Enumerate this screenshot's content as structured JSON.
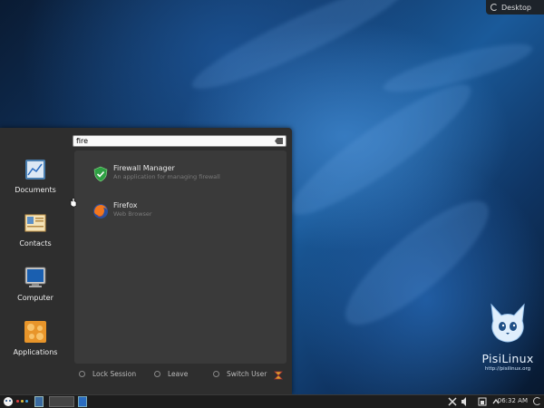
{
  "desktop_button": {
    "label": "Desktop"
  },
  "logo": {
    "brand": "PisiLinux",
    "url": "http://pisilinux.org"
  },
  "search": {
    "value": "fire"
  },
  "results": [
    {
      "title": "Firewall Manager",
      "description": "An application for managing firewall",
      "icon": "firewall-shield-icon"
    },
    {
      "title": "Firefox",
      "description": "Web Browser",
      "icon": "firefox-icon"
    }
  ],
  "favorites": [
    {
      "label": "Documents",
      "icon": "documents-icon"
    },
    {
      "label": "Contacts",
      "icon": "contacts-icon"
    },
    {
      "label": "Computer",
      "icon": "computer-icon"
    },
    {
      "label": "Applications",
      "icon": "applications-icon"
    }
  ],
  "actions": {
    "lock": "Lock Session",
    "leave": "Leave",
    "switch_user": "Switch User"
  },
  "taskbar": {
    "clock": "06:32 AM"
  },
  "colors": {
    "accent": "#2a6cc0",
    "menu_bg": "#2e2e2e",
    "panel": "#1d1d1d"
  }
}
